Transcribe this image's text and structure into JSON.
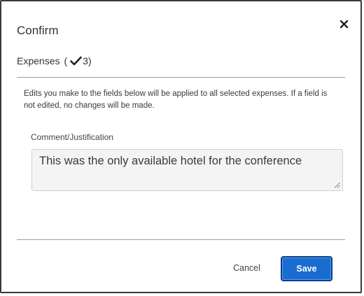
{
  "dialog": {
    "title": "Confirm",
    "close_icon": "close-icon"
  },
  "subtitle": {
    "label": "Expenses",
    "open_paren": "(",
    "check_icon": "check-icon",
    "count": "3",
    "close_paren": ")"
  },
  "info": {
    "text": "Edits you make to the fields below will be applied to all selected expenses. If a field is not edited, no changes will be made."
  },
  "comment": {
    "label": "Comment/Justification",
    "value": "This was the only available hotel for the conference"
  },
  "footer": {
    "cancel_label": "Cancel",
    "save_label": "Save"
  },
  "colors": {
    "primary": "#1a6cd1",
    "primary_border": "#0b3f87",
    "text": "#333333",
    "divider": "#9a9a9a",
    "field_bg": "#f4f4f4"
  }
}
